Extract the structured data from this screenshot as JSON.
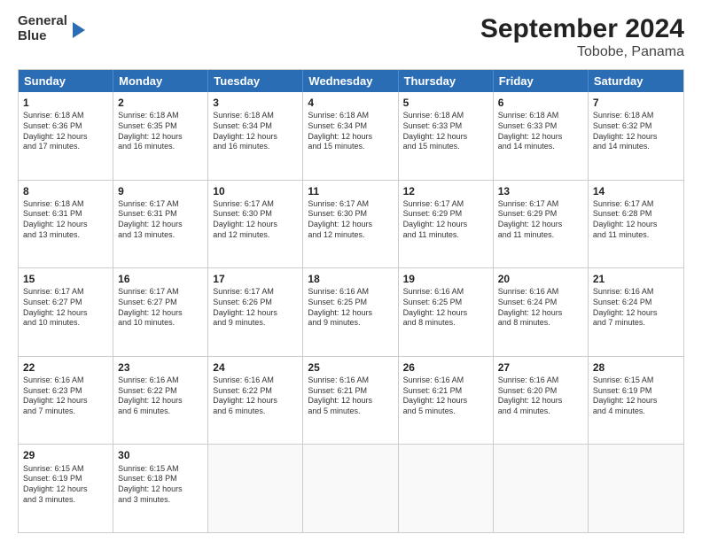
{
  "header": {
    "logo_line1": "General",
    "logo_line2": "Blue",
    "title": "September 2024",
    "subtitle": "Tobobe, Panama"
  },
  "calendar": {
    "headers": [
      "Sunday",
      "Monday",
      "Tuesday",
      "Wednesday",
      "Thursday",
      "Friday",
      "Saturday"
    ],
    "weeks": [
      [
        {
          "day": "",
          "info": ""
        },
        {
          "day": "",
          "info": ""
        },
        {
          "day": "",
          "info": ""
        },
        {
          "day": "",
          "info": ""
        },
        {
          "day": "",
          "info": ""
        },
        {
          "day": "",
          "info": ""
        },
        {
          "day": "",
          "info": ""
        }
      ],
      [
        {
          "day": "1",
          "info": "Sunrise: 6:18 AM\nSunset: 6:36 PM\nDaylight: 12 hours\nand 17 minutes."
        },
        {
          "day": "2",
          "info": "Sunrise: 6:18 AM\nSunset: 6:35 PM\nDaylight: 12 hours\nand 16 minutes."
        },
        {
          "day": "3",
          "info": "Sunrise: 6:18 AM\nSunset: 6:34 PM\nDaylight: 12 hours\nand 16 minutes."
        },
        {
          "day": "4",
          "info": "Sunrise: 6:18 AM\nSunset: 6:34 PM\nDaylight: 12 hours\nand 15 minutes."
        },
        {
          "day": "5",
          "info": "Sunrise: 6:18 AM\nSunset: 6:33 PM\nDaylight: 12 hours\nand 15 minutes."
        },
        {
          "day": "6",
          "info": "Sunrise: 6:18 AM\nSunset: 6:33 PM\nDaylight: 12 hours\nand 14 minutes."
        },
        {
          "day": "7",
          "info": "Sunrise: 6:18 AM\nSunset: 6:32 PM\nDaylight: 12 hours\nand 14 minutes."
        }
      ],
      [
        {
          "day": "8",
          "info": "Sunrise: 6:18 AM\nSunset: 6:31 PM\nDaylight: 12 hours\nand 13 minutes."
        },
        {
          "day": "9",
          "info": "Sunrise: 6:17 AM\nSunset: 6:31 PM\nDaylight: 12 hours\nand 13 minutes."
        },
        {
          "day": "10",
          "info": "Sunrise: 6:17 AM\nSunset: 6:30 PM\nDaylight: 12 hours\nand 12 minutes."
        },
        {
          "day": "11",
          "info": "Sunrise: 6:17 AM\nSunset: 6:30 PM\nDaylight: 12 hours\nand 12 minutes."
        },
        {
          "day": "12",
          "info": "Sunrise: 6:17 AM\nSunset: 6:29 PM\nDaylight: 12 hours\nand 11 minutes."
        },
        {
          "day": "13",
          "info": "Sunrise: 6:17 AM\nSunset: 6:29 PM\nDaylight: 12 hours\nand 11 minutes."
        },
        {
          "day": "14",
          "info": "Sunrise: 6:17 AM\nSunset: 6:28 PM\nDaylight: 12 hours\nand 11 minutes."
        }
      ],
      [
        {
          "day": "15",
          "info": "Sunrise: 6:17 AM\nSunset: 6:27 PM\nDaylight: 12 hours\nand 10 minutes."
        },
        {
          "day": "16",
          "info": "Sunrise: 6:17 AM\nSunset: 6:27 PM\nDaylight: 12 hours\nand 10 minutes."
        },
        {
          "day": "17",
          "info": "Sunrise: 6:17 AM\nSunset: 6:26 PM\nDaylight: 12 hours\nand 9 minutes."
        },
        {
          "day": "18",
          "info": "Sunrise: 6:16 AM\nSunset: 6:25 PM\nDaylight: 12 hours\nand 9 minutes."
        },
        {
          "day": "19",
          "info": "Sunrise: 6:16 AM\nSunset: 6:25 PM\nDaylight: 12 hours\nand 8 minutes."
        },
        {
          "day": "20",
          "info": "Sunrise: 6:16 AM\nSunset: 6:24 PM\nDaylight: 12 hours\nand 8 minutes."
        },
        {
          "day": "21",
          "info": "Sunrise: 6:16 AM\nSunset: 6:24 PM\nDaylight: 12 hours\nand 7 minutes."
        }
      ],
      [
        {
          "day": "22",
          "info": "Sunrise: 6:16 AM\nSunset: 6:23 PM\nDaylight: 12 hours\nand 7 minutes."
        },
        {
          "day": "23",
          "info": "Sunrise: 6:16 AM\nSunset: 6:22 PM\nDaylight: 12 hours\nand 6 minutes."
        },
        {
          "day": "24",
          "info": "Sunrise: 6:16 AM\nSunset: 6:22 PM\nDaylight: 12 hours\nand 6 minutes."
        },
        {
          "day": "25",
          "info": "Sunrise: 6:16 AM\nSunset: 6:21 PM\nDaylight: 12 hours\nand 5 minutes."
        },
        {
          "day": "26",
          "info": "Sunrise: 6:16 AM\nSunset: 6:21 PM\nDaylight: 12 hours\nand 5 minutes."
        },
        {
          "day": "27",
          "info": "Sunrise: 6:16 AM\nSunset: 6:20 PM\nDaylight: 12 hours\nand 4 minutes."
        },
        {
          "day": "28",
          "info": "Sunrise: 6:15 AM\nSunset: 6:19 PM\nDaylight: 12 hours\nand 4 minutes."
        }
      ],
      [
        {
          "day": "29",
          "info": "Sunrise: 6:15 AM\nSunset: 6:19 PM\nDaylight: 12 hours\nand 3 minutes."
        },
        {
          "day": "30",
          "info": "Sunrise: 6:15 AM\nSunset: 6:18 PM\nDaylight: 12 hours\nand 3 minutes."
        },
        {
          "day": "",
          "info": ""
        },
        {
          "day": "",
          "info": ""
        },
        {
          "day": "",
          "info": ""
        },
        {
          "day": "",
          "info": ""
        },
        {
          "day": "",
          "info": ""
        }
      ]
    ]
  }
}
